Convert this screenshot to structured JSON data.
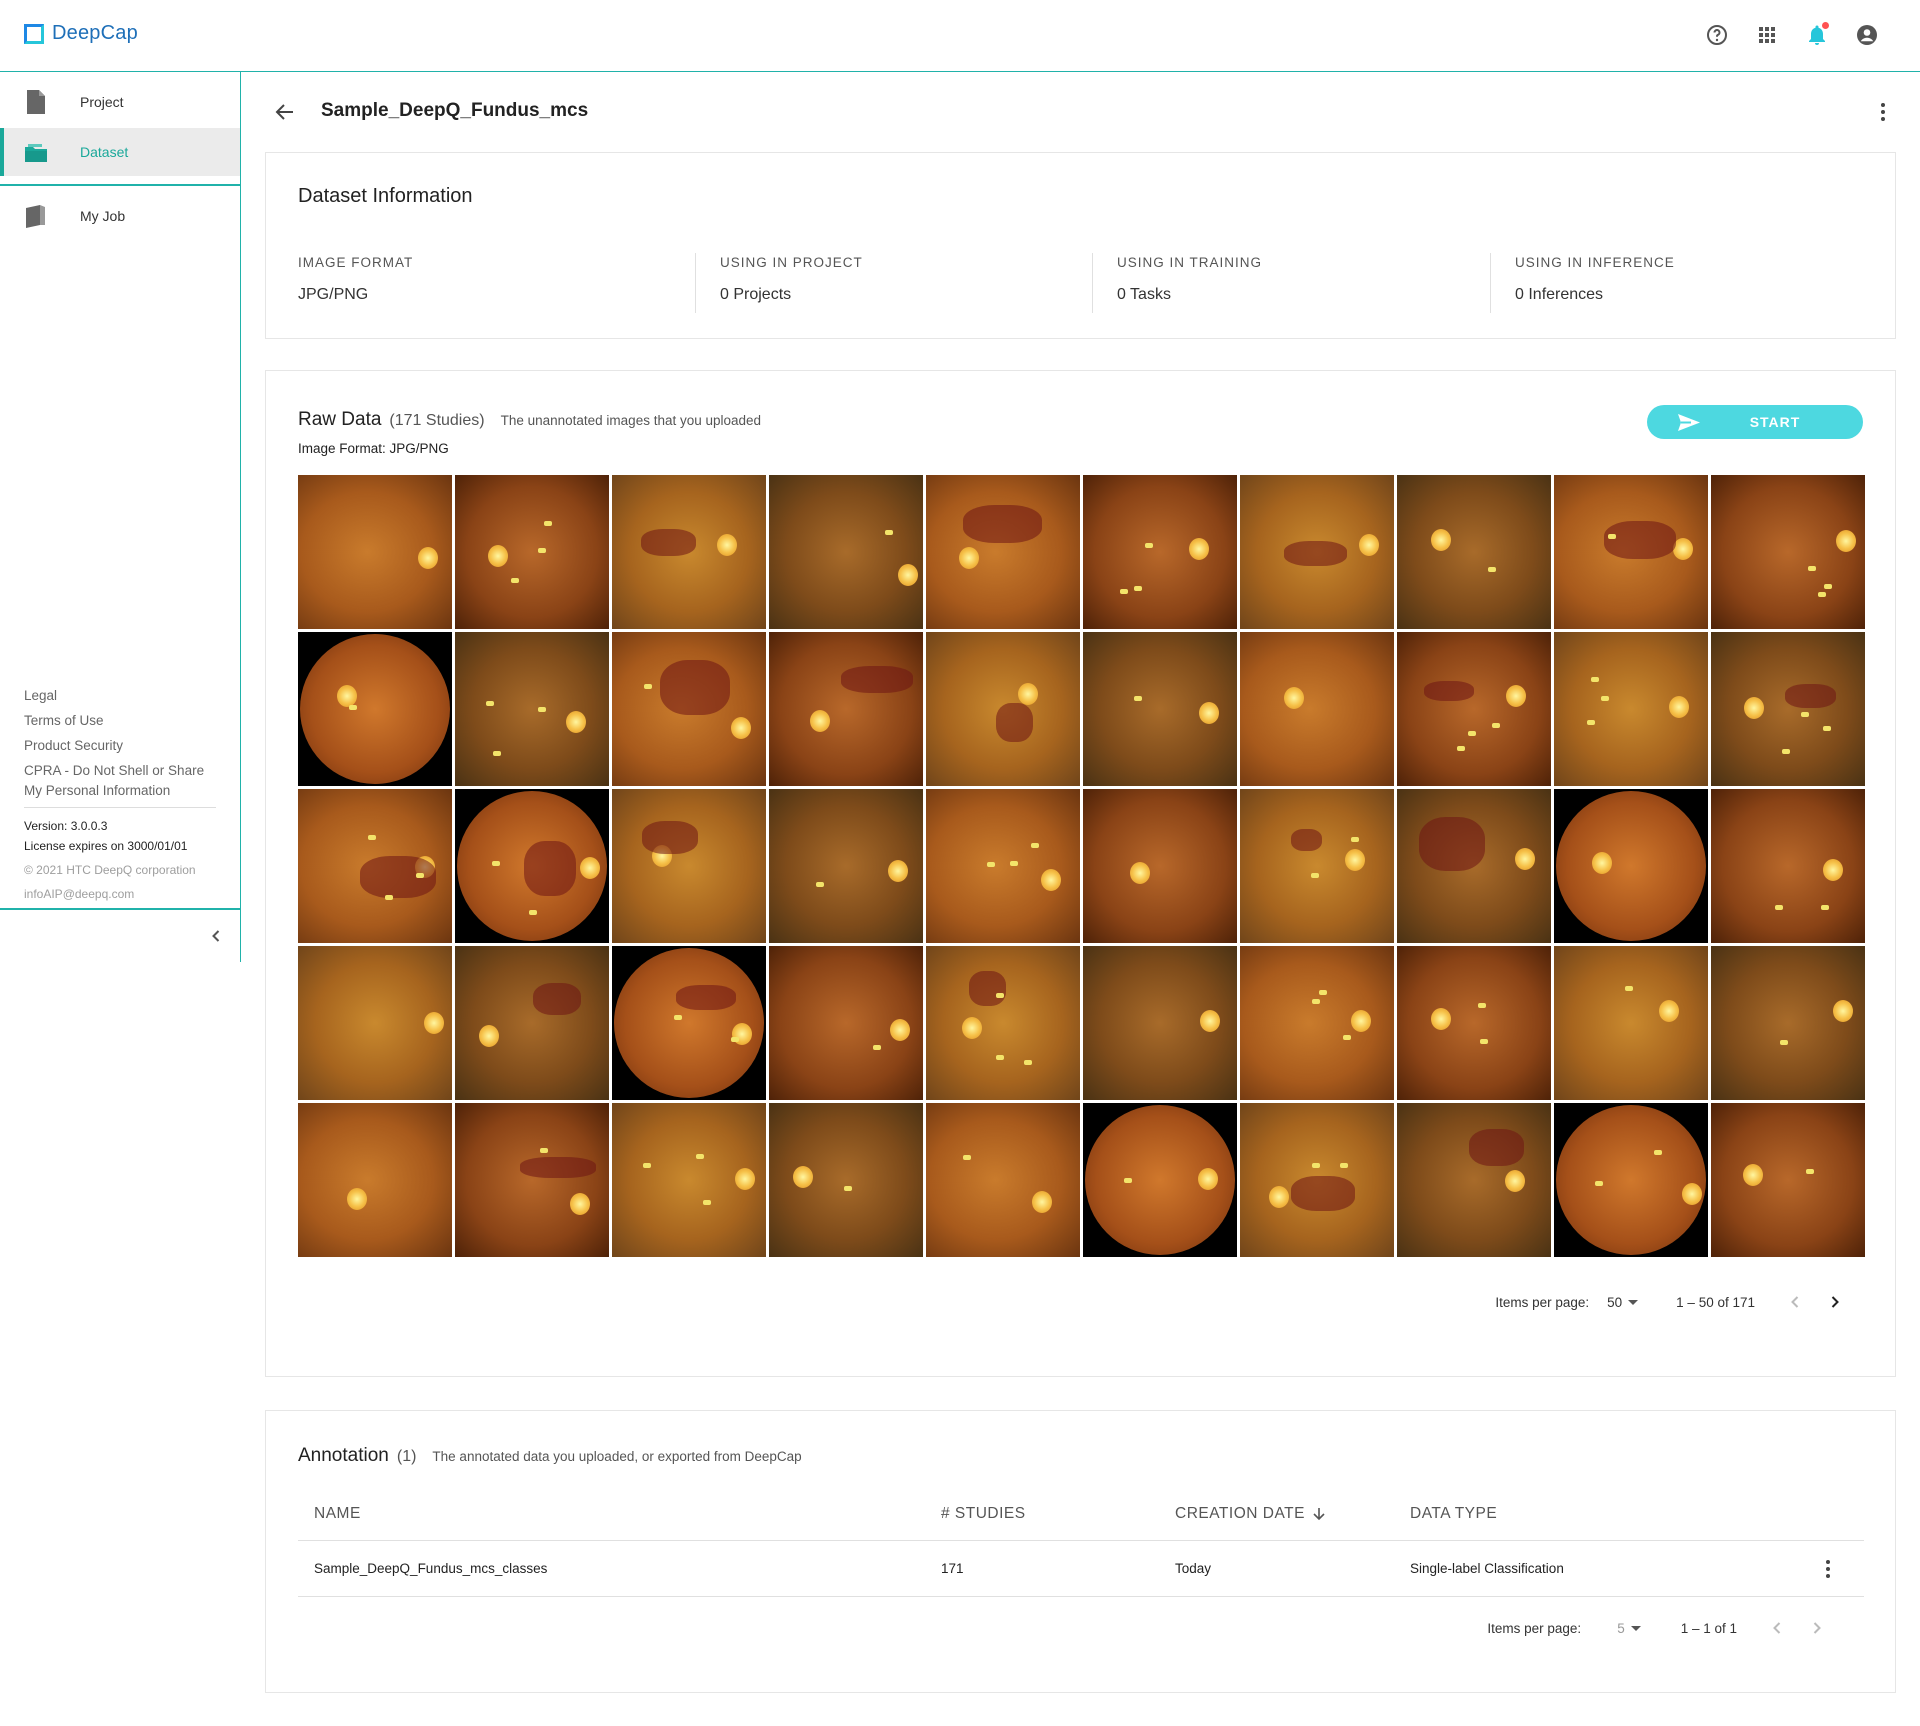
{
  "app": {
    "name": "DeepCap"
  },
  "header": {
    "icons": [
      "help-icon",
      "apps-grid-icon",
      "bell-icon",
      "account-icon"
    ]
  },
  "sidebar": {
    "items": [
      {
        "label": "Project",
        "icon": "file-icon",
        "active": false
      },
      {
        "label": "Dataset",
        "icon": "folder-open-icon",
        "active": true
      },
      {
        "label": "My Job",
        "icon": "book-icon",
        "active": false
      }
    ],
    "links": [
      "Legal",
      "Terms of Use",
      "Product Security",
      "CPRA - Do Not Shell or Share My Personal Information"
    ],
    "version": "Version: 3.0.0.3",
    "license": "License expires on 3000/01/01",
    "copyright": "© 2021 HTC DeepQ corporation",
    "email": "infoAIP@deepq.com"
  },
  "page": {
    "title": "Sample_DeepQ_Fundus_mcs"
  },
  "dataset_info": {
    "title": "Dataset Information",
    "columns": [
      {
        "label": "IMAGE FORMAT",
        "value": "JPG/PNG"
      },
      {
        "label": "USING IN PROJECT",
        "value": "0 Projects"
      },
      {
        "label": "USING IN TRAINING",
        "value": "0 Tasks"
      },
      {
        "label": "USING IN INFERENCE",
        "value": "0 Inferences"
      }
    ]
  },
  "raw_data": {
    "title": "Raw Data",
    "count": "(171 Studies)",
    "description": "The unannotated images that you uploaded",
    "format": "Image Format: JPG/PNG",
    "start_label": "START",
    "image_count_shown": 50,
    "pager": {
      "label": "Items per page:",
      "per_page": "50",
      "range": "1 – 50 of 171"
    }
  },
  "annotation": {
    "title": "Annotation",
    "count": "(1)",
    "description": "The annotated data you uploaded, or exported from DeepCap",
    "columns": [
      "NAME",
      "# STUDIES",
      "CREATION DATE",
      "DATA TYPE"
    ],
    "rows": [
      {
        "name": "Sample_DeepQ_Fundus_mcs_classes",
        "studies": "171",
        "date": "Today",
        "type": "Single-label Classification"
      }
    ],
    "pager": {
      "label": "Items per page:",
      "per_page": "5",
      "range": "1 – 1 of 1"
    }
  },
  "colors": {
    "accent": "#1aa89a",
    "start_button": "#4dd8e0",
    "notification": "#ff5252"
  }
}
